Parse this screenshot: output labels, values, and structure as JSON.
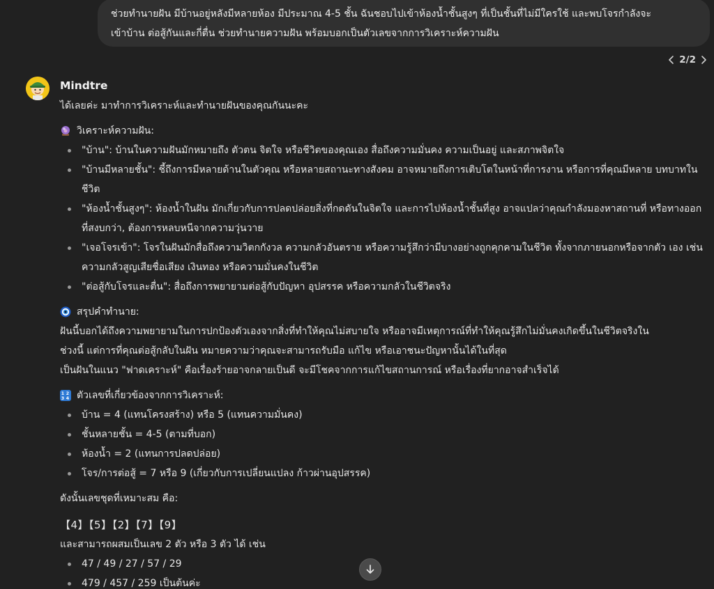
{
  "user_message": {
    "line1": "ช่วยทำนายฝัน มีบ้านอยู่หลังมีหลายห้อง มีประมาณ 4-5 ชั้น ฉันชอบไปเข้าห้องน้ำชั้นสูงๆ ที่เป็นชั้นที่ไม่มีใครใช้ และพบโจรกำลังจะ",
    "line2": "เข้าบ้าน ต่อสู้กันและกี่ตื่น ช่วยทำนายความฝัน พร้อมบอกเป็นตัวเลขจากการวิเคราะห์ความฝัน"
  },
  "pager": {
    "label": "2/2",
    "prev_icon": "chevron-left-icon",
    "next_icon": "chevron-right-icon"
  },
  "assistant": {
    "name": "Mindtre",
    "avatar_icon": "avatar-icon",
    "intro": "ได้เลยค่ะ มาทำการวิเคราะห์และทำนายฝันของคุณกันนะคะ",
    "analysis": {
      "icon": "crystal-ball-icon",
      "heading": "วิเคราะห์ความฝัน:",
      "items": [
        "\"บ้าน\": บ้านในความฝันมักหมายถึง ตัวตน จิตใจ หรือชีวิตของคุณเอง สื่อถึงความมั่นคง ความเป็นอยู่ และสภาพจิตใจ",
        "\"บ้านมีหลายชั้น\": ชี้ถึงการมีหลายด้านในตัวคุณ หรือหลายสถานะทางสังคม อาจหมายถึงการเติบโตในหน้าที่การงาน หรือการที่คุณมีหลาย บทบาทในชีวิต",
        "\"ห้องน้ำชั้นสูงๆ\": ห้องน้ำในฝัน มักเกี่ยวกับการปลดปล่อยสิ่งที่กดดันในจิตใจ และการไปห้องน้ำชั้นที่สูง อาจแปลว่าคุณกำลังมองหาสถานที่ หรือทางออกที่สงบกว่า, ต้องการหลบหนีจากความวุ่นวาย",
        "\"เจอโจรเข้า\": โจรในฝันมักสื่อถึงความวิตกกังวล ความกลัวอันตราย หรือความรู้สึกว่ามีบางอย่างถูกคุกคามในชีวิต ทั้งจากภายนอกหรือจากตัว เอง เช่น ความกลัวสูญเสียชื่อเสียง เงินทอง หรือความมั่นคงในชีวิต",
        "\"ต่อสู้กับโจรและตื่น\": สื่อถึงการพยายามต่อสู้กับปัญหา อุปสรรค หรือความกลัวในชีวิตจริง"
      ]
    },
    "summary": {
      "icon": "nazar-eye-icon",
      "heading": "สรุปคำทำนาย:",
      "line1": "ฝันนี้บอกได้ถึงความพยายามในการปกป้องตัวเองจากสิ่งที่ทำให้คุณไม่สบายใจ หรืออาจมีเหตุการณ์ที่ทำให้คุณรู้สึกไม่มั่นคงเกิดขึ้นในชีวิตจริงใน",
      "line2": "ช่วงนี้ แต่การที่คุณต่อสู้กลับในฝัน หมายความว่าคุณจะสามารถรับมือ แก้ไข หรือเอาชนะปัญหานั้นได้ในที่สุด",
      "line3": "เป็นฝันในแนว \"ฟาดเคราะห์\" คือเรื่องร้ายอาจกลายเป็นดี จะมีโชคจากการแก้ไขสถานการณ์ หรือเรื่องที่ยากอาจสำเร็จได้"
    },
    "numbers_section": {
      "icon": "numbers-icon",
      "heading": "ตัวเลขที่เกี่ยวข้องจากการวิเคราะห์:",
      "items": [
        "บ้าน = 4 (แทนโครงสร้าง) หรือ 5 (แทนความมั่นคง)",
        "ชั้นหลายชั้น = 4-5 (ตามที่บอก)",
        "ห้องน้ำ = 2 (แทนการปลดปล่อย)",
        "โจร/การต่อสู้ = 7 หรือ 9 (เกี่ยวกับการเปลี่ยนแปลง ก้าวผ่านอุปสรรค)"
      ]
    },
    "set_intro": "ดังนั้นเลขชุดที่เหมาะสม คือ:",
    "number_set": "【4】【5】【2】【7】【9】",
    "combo_intro": "และสามารถผสมเป็นเลข 2 ตัว หรือ 3 ตัว ได้ เช่น",
    "combos": [
      "47 / 49 / 27 / 57 / 29",
      "479 / 457 / 259 เป็นต้นค่ะ"
    ]
  },
  "scroll_down": {
    "icon": "arrow-down-icon"
  },
  "colors": {
    "background": "#212121",
    "user_bubble": "#303030",
    "text": "#ececec",
    "numbers_icon_blue": "#2f7bd6"
  }
}
